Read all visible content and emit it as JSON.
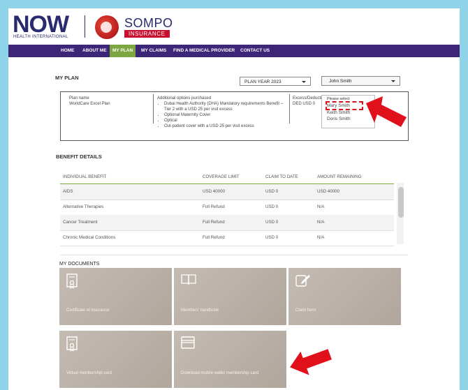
{
  "brand": {
    "now": "NOW",
    "now_sub": "HEALTH INTERNATIONAL",
    "sompo": "SOMPO",
    "sompo_sub": "INSURANCE"
  },
  "nav": {
    "items": [
      "HOME",
      "ABOUT ME",
      "MY PLAN",
      "MY CLAIMS",
      "FIND A MEDICAL PROVIDER",
      "CONTACT US"
    ],
    "active": "MY PLAN"
  },
  "my_plan": {
    "title": "MY PLAN",
    "plan_year_select": "PLAN YEAR 2023",
    "member_select": "John Smith",
    "plan_name_label": "Plan name",
    "plan_name_value": "WorldCare Excel Plan",
    "options_label": "Additional options purchased",
    "options": [
      "Dubai Health Authority (DHA) Mandatory requirements Benefit – Tier 2 with a USD 25 per visit excess",
      "Optional Maternity Cover",
      "Optical",
      "Out-patient cover with a USD 25 per visit excess"
    ],
    "excess_label": "Excess/Deductib",
    "excess_value": "DED USD 0"
  },
  "member_dropdown": {
    "placeholder": "Please select",
    "options": [
      "Mary Smith",
      "Keith Smith",
      "Doris Smith"
    ],
    "highlighted": "Mary Smith"
  },
  "benefit_details": {
    "title": "BENEFIT DETAILS",
    "columns": [
      "INDIVIDUAL BENEFIT",
      "COVERAGE LIMIT",
      "CLAIM TO DATE",
      "AMOUNT REMAINING"
    ],
    "rows": [
      [
        "AIDS",
        "USD 40000",
        "USD 0",
        "USD 40000"
      ],
      [
        "Alternative Therapies",
        "Full Refund",
        "USD 0",
        "N/A"
      ],
      [
        "Cancer Treatment",
        "Full Refund",
        "USD 0",
        "N/A"
      ],
      [
        "Chronic Medical Conditions",
        "Full Refund",
        "USD 0",
        "N/A"
      ]
    ]
  },
  "documents": {
    "title": "MY DOCUMENTS",
    "tiles": [
      {
        "label": "Certificate of insurance",
        "icon": "certificate-icon"
      },
      {
        "label": "Members' handbook",
        "icon": "book-icon"
      },
      {
        "label": "Claim form",
        "icon": "edit-form-icon"
      },
      {
        "label": "Virtual membership card",
        "icon": "certificate-icon"
      },
      {
        "label": "Download mobile wallet membership card",
        "icon": "wallet-icon"
      }
    ]
  },
  "colors": {
    "nav_bg": "#3d2578",
    "nav_active": "#7da640",
    "highlight_red": "#d4121c",
    "page_border": "#8fd3e8"
  }
}
